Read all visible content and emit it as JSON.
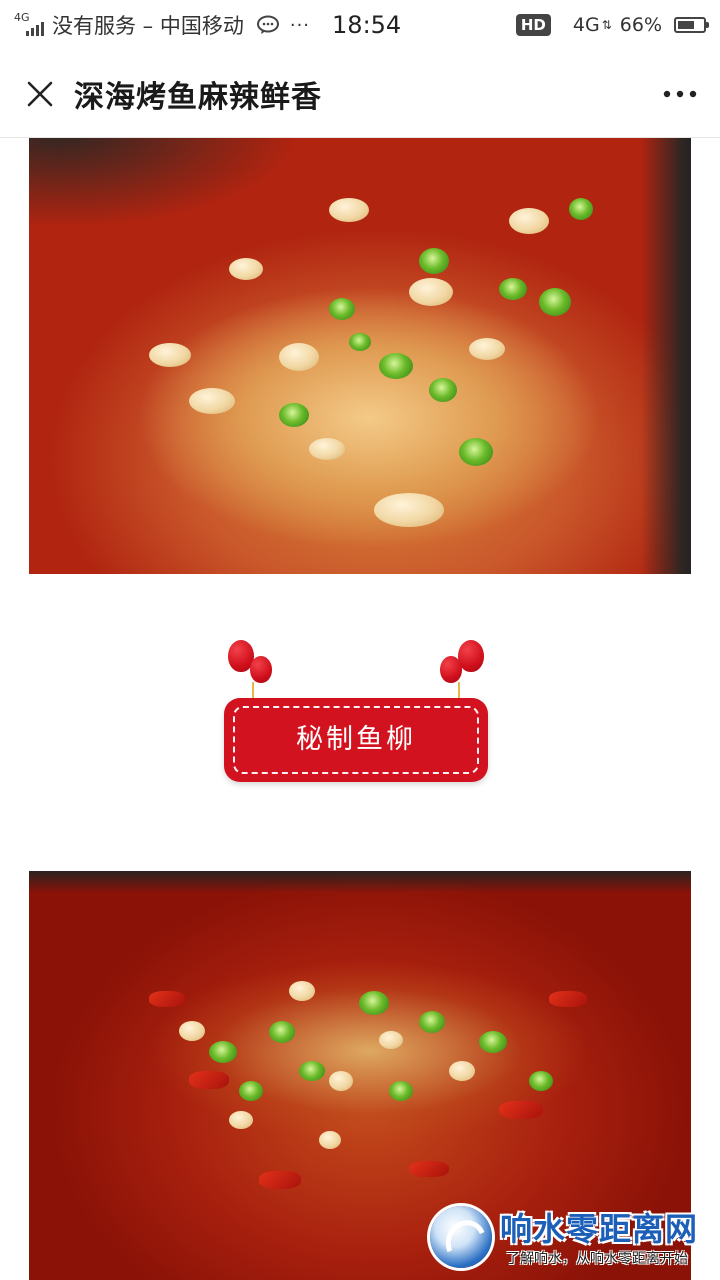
{
  "status_bar": {
    "network_type": "4G",
    "signal_bars": 4,
    "carrier": "没有服务 – 中国移动",
    "more_dots": "···",
    "time": "18:54",
    "hd_badge": "HD",
    "network_right": "4G",
    "battery_percent": "66%",
    "battery_level": 0.66,
    "icons": [
      "signal-icon",
      "wechat-icon",
      "battery-icon"
    ]
  },
  "nav": {
    "title": "深海烤鱼麻辣鲜香",
    "close_icon": "close-icon",
    "more_icon": "more-icon"
  },
  "content": {
    "photo_1": "grilled-fish-photo",
    "badge_label": "秘制鱼柳",
    "photo_2": "spicy-fish-photo",
    "accent_color": "#d3121f"
  },
  "watermark": {
    "title": "响水零距离网",
    "slogan": "了解响水，从响水零距离开始",
    "brand_color": "#1c5fb8"
  }
}
